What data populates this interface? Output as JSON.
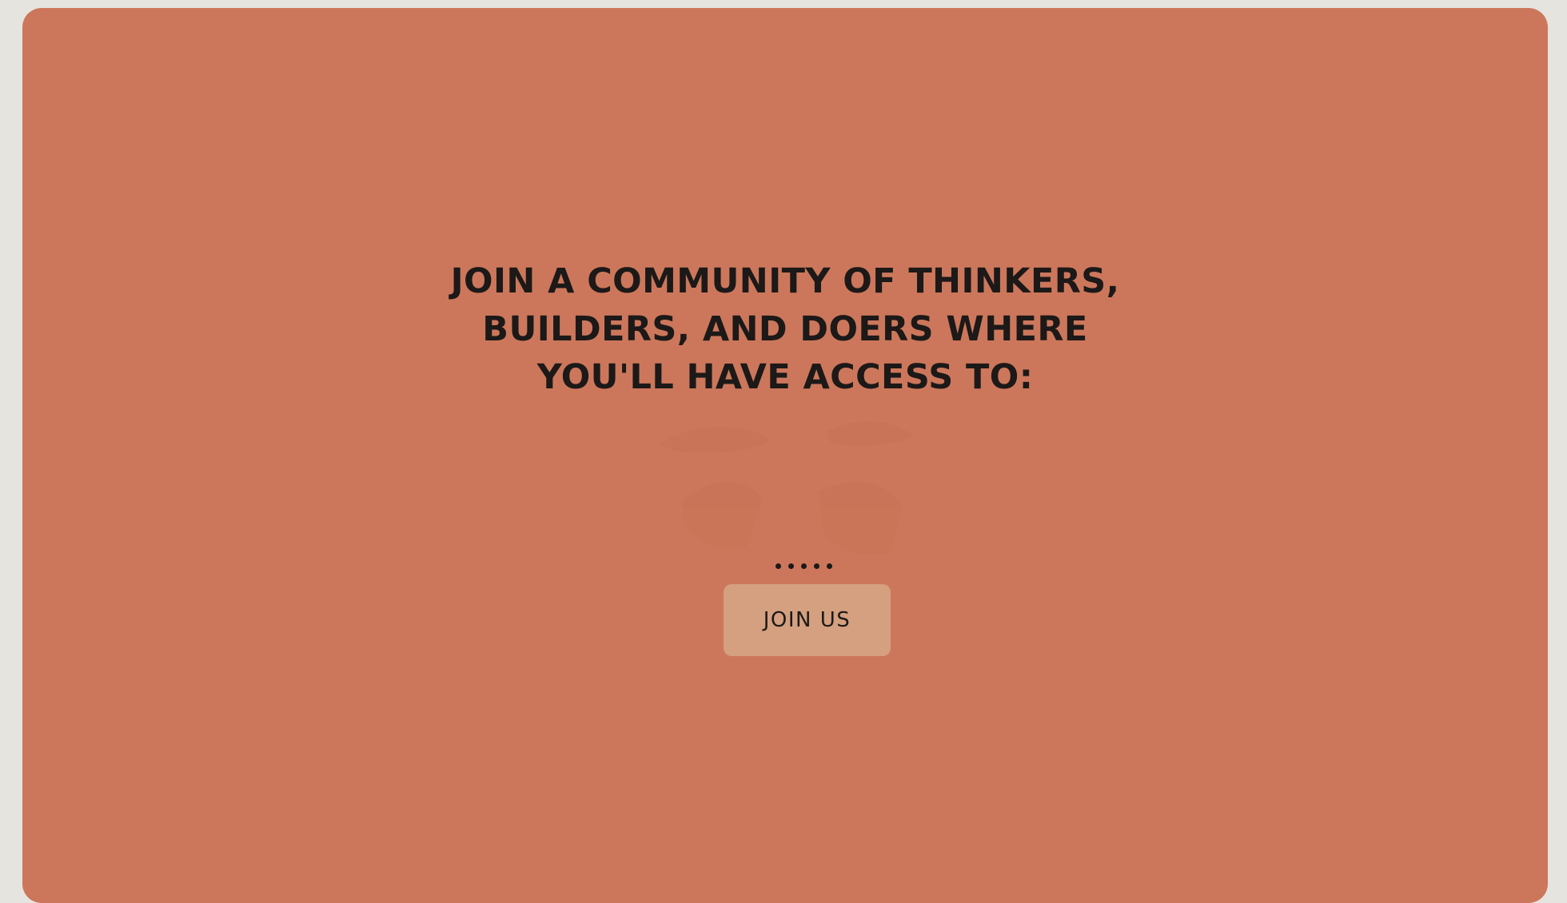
{
  "colors": {
    "page_background": "#e6e4df",
    "card_background": "#cc775b",
    "text": "#1c1918",
    "button_background": "#d4a07f"
  },
  "headline": {
    "lines": [
      "JOIN A COMMUNITY OF THINKERS,",
      "BUILDERS, AND DOERS WHERE",
      "YOU'LL HAVE ACCESS TO:"
    ]
  },
  "carousel": {
    "dot_count": 5
  },
  "cta": {
    "label": "JOIN US"
  }
}
